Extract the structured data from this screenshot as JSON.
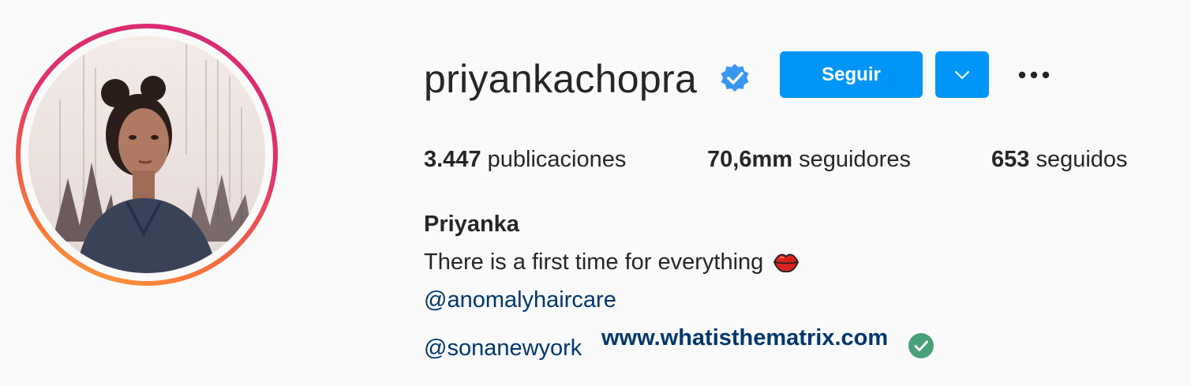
{
  "profile": {
    "username": "priyankachopra",
    "full_name": "Priyanka",
    "verified": true,
    "verified_icon": "verified-badge-icon"
  },
  "actions": {
    "follow_label": "Seguir",
    "dropdown_icon": "chevron-down-icon",
    "more_icon": "more-options-icon"
  },
  "stats": {
    "posts_count": "3.447",
    "posts_label": "publicaciones",
    "followers_count": "70,6mm",
    "followers_label": "seguidores",
    "following_count": "653",
    "following_label": "seguidos"
  },
  "bio": {
    "line1": "There is a first time for everything",
    "line1_emoji_icon": "kiss-lips-icon",
    "mention1": "@anomalyhaircare",
    "mention2": "@sonanewyork",
    "website": "www.whatisthematrix.com",
    "website_check_icon": "check-circle-icon"
  },
  "colors": {
    "accent": "#0095f6",
    "link": "#00376b",
    "text": "#262626",
    "background": "#fafafa",
    "verified": "#3897f0",
    "check": "#4aa07a"
  }
}
